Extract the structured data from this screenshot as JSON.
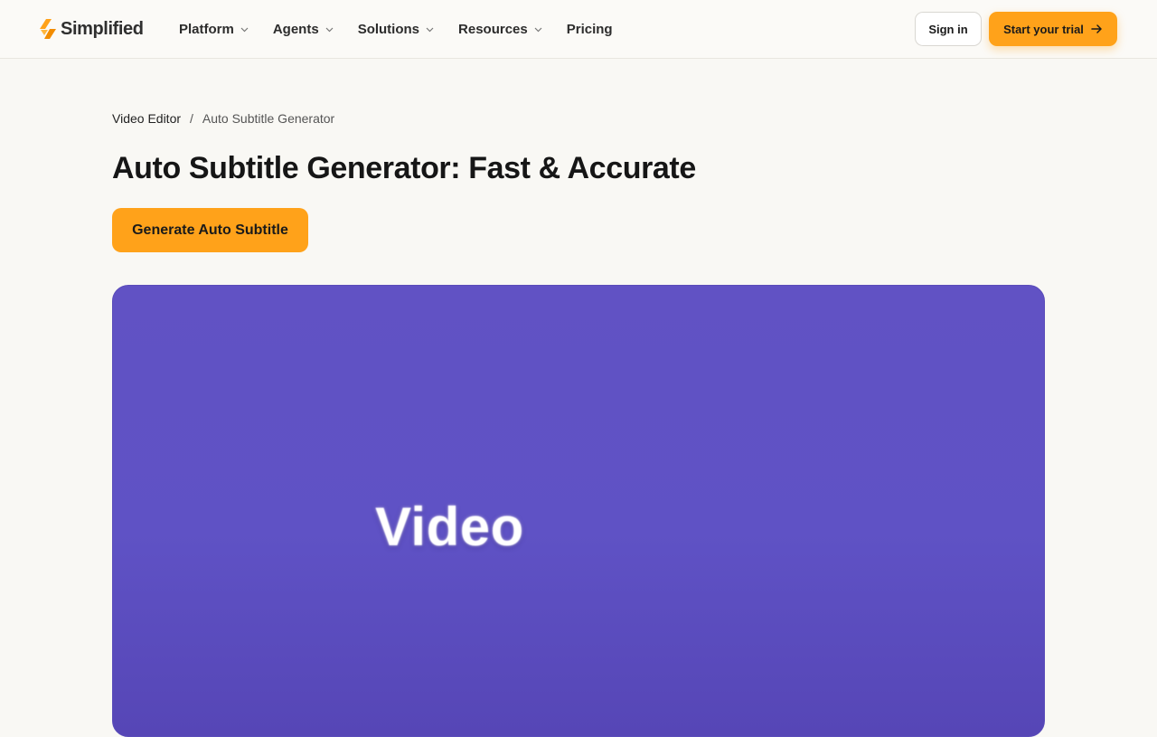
{
  "header": {
    "logo_text": "Simplified",
    "nav": [
      {
        "label": "Platform",
        "has_dropdown": true
      },
      {
        "label": "Agents",
        "has_dropdown": true
      },
      {
        "label": "Solutions",
        "has_dropdown": true
      },
      {
        "label": "Resources",
        "has_dropdown": true
      },
      {
        "label": "Pricing",
        "has_dropdown": false
      }
    ],
    "signin_label": "Sign in",
    "trial_label": "Start your trial"
  },
  "breadcrumb": {
    "parent": "Video Editor",
    "separator": "/",
    "current": "Auto Subtitle Generator"
  },
  "main": {
    "title": "Auto Subtitle Generator: Fast & Accurate",
    "cta_label": "Generate Auto Subtitle",
    "video_text": "Video"
  },
  "colors": {
    "accent": "#ffa21a",
    "video_bg": "#6152c4",
    "page_bg": "#f9f8f4"
  }
}
